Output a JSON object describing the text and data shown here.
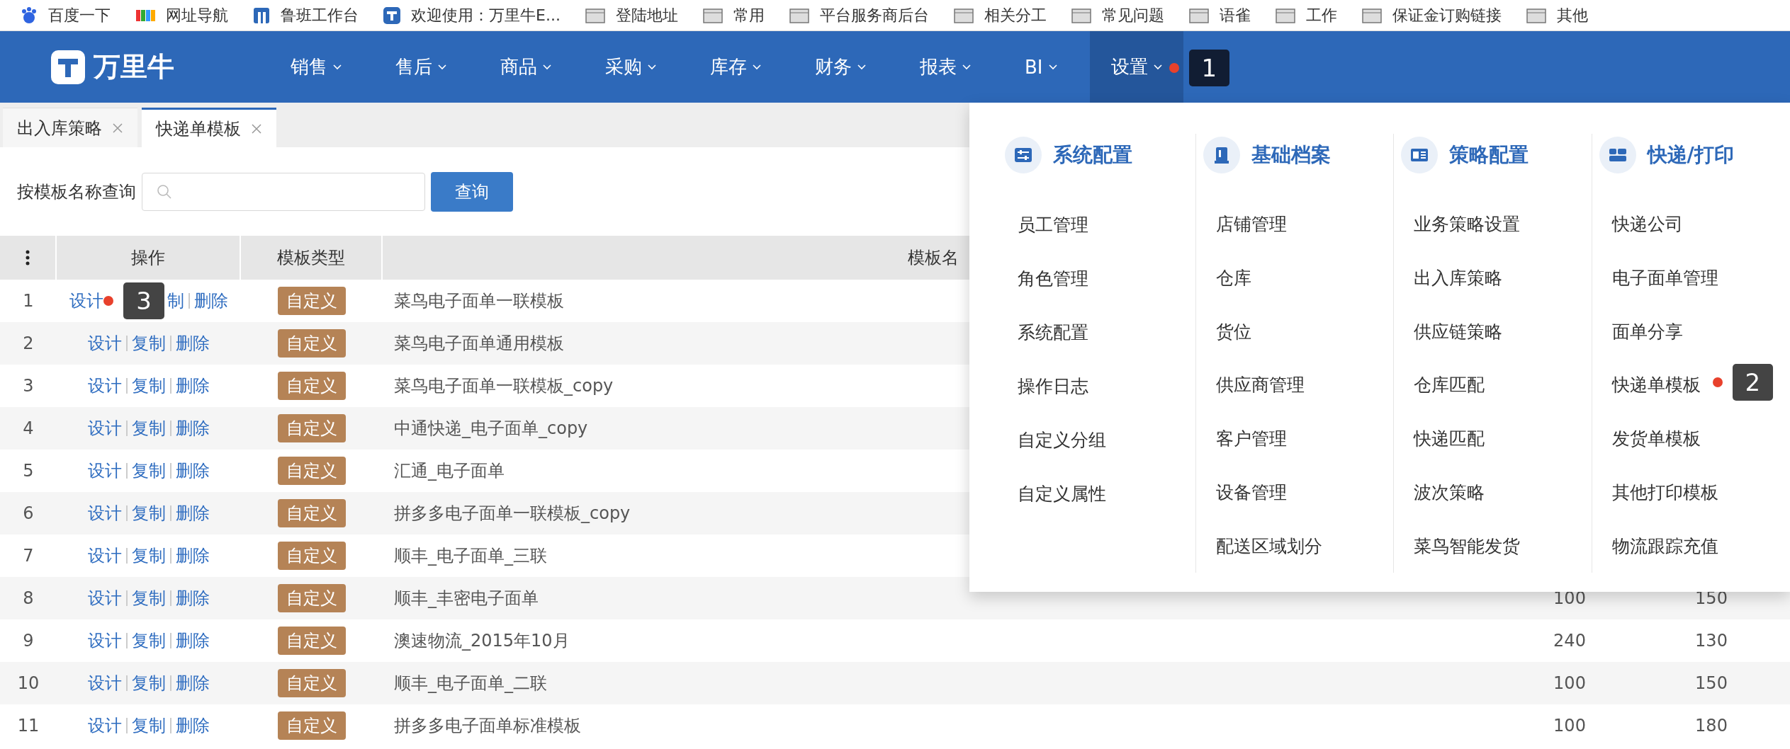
{
  "bookmarks": [
    {
      "label": "百度一下",
      "kind": "baidu"
    },
    {
      "label": "网址导航",
      "kind": "nav2345"
    },
    {
      "label": "鲁班工作台",
      "kind": "luban"
    },
    {
      "label": "欢迎使用：万里牛E...",
      "kind": "app"
    },
    {
      "label": "登陆地址",
      "kind": "folder"
    },
    {
      "label": "常用",
      "kind": "folder"
    },
    {
      "label": "平台服务商后台",
      "kind": "folder"
    },
    {
      "label": "相关分工",
      "kind": "folder"
    },
    {
      "label": "常见问题",
      "kind": "folder"
    },
    {
      "label": "语雀",
      "kind": "folder"
    },
    {
      "label": "工作",
      "kind": "folder"
    },
    {
      "label": "保证金订购链接",
      "kind": "folder"
    },
    {
      "label": "其他",
      "kind": "folder"
    }
  ],
  "header": {
    "logo": "万里牛",
    "menu": [
      {
        "label": "销售",
        "selected": false
      },
      {
        "label": "售后",
        "selected": false
      },
      {
        "label": "商品",
        "selected": false
      },
      {
        "label": "采购",
        "selected": false
      },
      {
        "label": "库存",
        "selected": false
      },
      {
        "label": "财务",
        "selected": false
      },
      {
        "label": "报表",
        "selected": false
      },
      {
        "label": "BI",
        "selected": false
      },
      {
        "label": "设置",
        "selected": true,
        "callout": "1"
      }
    ]
  },
  "tabs": [
    {
      "label": "出入库策略",
      "selected": false
    },
    {
      "label": "快递单模板",
      "selected": true
    }
  ],
  "search": {
    "label": "按模板名称查询",
    "button": "查询"
  },
  "table": {
    "columns": [
      "操作",
      "模板类型",
      "模板名"
    ],
    "rows": [
      {
        "index": "1",
        "actions": [
          "设计",
          "制",
          "删除"
        ],
        "type": "自定义",
        "name": "菜鸟电子面单一联模板",
        "callout": "3"
      },
      {
        "index": "2",
        "actions": [
          "设计",
          "复制",
          "删除"
        ],
        "type": "自定义",
        "name": "菜鸟电子面单通用模板"
      },
      {
        "index": "3",
        "actions": [
          "设计",
          "复制",
          "删除"
        ],
        "type": "自定义",
        "name": "菜鸟电子面单一联模板_copy"
      },
      {
        "index": "4",
        "actions": [
          "设计",
          "复制",
          "删除"
        ],
        "type": "自定义",
        "name": "中通快递_电子面单_copy"
      },
      {
        "index": "5",
        "actions": [
          "设计",
          "复制",
          "删除"
        ],
        "type": "自定义",
        "name": "汇通_电子面单"
      },
      {
        "index": "6",
        "actions": [
          "设计",
          "复制",
          "删除"
        ],
        "type": "自定义",
        "name": "拼多多电子面单一联模板_copy"
      },
      {
        "index": "7",
        "actions": [
          "设计",
          "复制",
          "删除"
        ],
        "type": "自定义",
        "name": "顺丰_电子面单_三联"
      },
      {
        "index": "8",
        "actions": [
          "设计",
          "复制",
          "删除"
        ],
        "type": "自定义",
        "name": "顺丰_丰密电子面单",
        "column_4": "100",
        "column_5": "150"
      },
      {
        "index": "9",
        "actions": [
          "设计",
          "复制",
          "删除"
        ],
        "type": "自定义",
        "name": "澳速物流_2015年10月",
        "column_4": "240",
        "column_5": "130"
      },
      {
        "index": "10",
        "actions": [
          "设计",
          "复制",
          "删除"
        ],
        "type": "自定义",
        "name": "顺丰_电子面单_二联",
        "column_4": "100",
        "column_5": "150"
      },
      {
        "index": "11",
        "actions": [
          "设计",
          "复制",
          "删除"
        ],
        "type": "自定义",
        "name": "拼多多电子面单标准模板",
        "column_4": "100",
        "column_5": "180"
      }
    ]
  },
  "dropdown": {
    "groups": [
      {
        "title": "系统配置",
        "kind": "sliders",
        "items": [
          {
            "label": "员工管理"
          },
          {
            "label": "角色管理"
          },
          {
            "label": "系统配置"
          },
          {
            "label": "操作日志"
          },
          {
            "label": "自定义分组"
          },
          {
            "label": "自定义属性"
          }
        ]
      },
      {
        "title": "基础档案",
        "kind": "book",
        "items": [
          {
            "label": "店铺管理"
          },
          {
            "label": "仓库"
          },
          {
            "label": "货位"
          },
          {
            "label": "供应商管理"
          },
          {
            "label": "客户管理"
          },
          {
            "label": "设备管理"
          },
          {
            "label": "配送区域划分"
          }
        ]
      },
      {
        "title": "策略配置",
        "kind": "card",
        "items": [
          {
            "label": "业务策略设置"
          },
          {
            "label": "出入库策略"
          },
          {
            "label": "供应链策略"
          },
          {
            "label": "仓库匹配"
          },
          {
            "label": "快递匹配"
          },
          {
            "label": "波次策略"
          },
          {
            "label": "菜鸟智能发货"
          }
        ]
      },
      {
        "title": "快递/打印",
        "kind": "blocks",
        "items": [
          {
            "label": "快递公司"
          },
          {
            "label": "电子面单管理"
          },
          {
            "label": "面单分享"
          },
          {
            "label": "快递单模板",
            "callout": "2"
          },
          {
            "label": "发货单模板"
          },
          {
            "label": "其他打印模板"
          },
          {
            "label": "物流跟踪充值"
          }
        ]
      }
    ]
  }
}
